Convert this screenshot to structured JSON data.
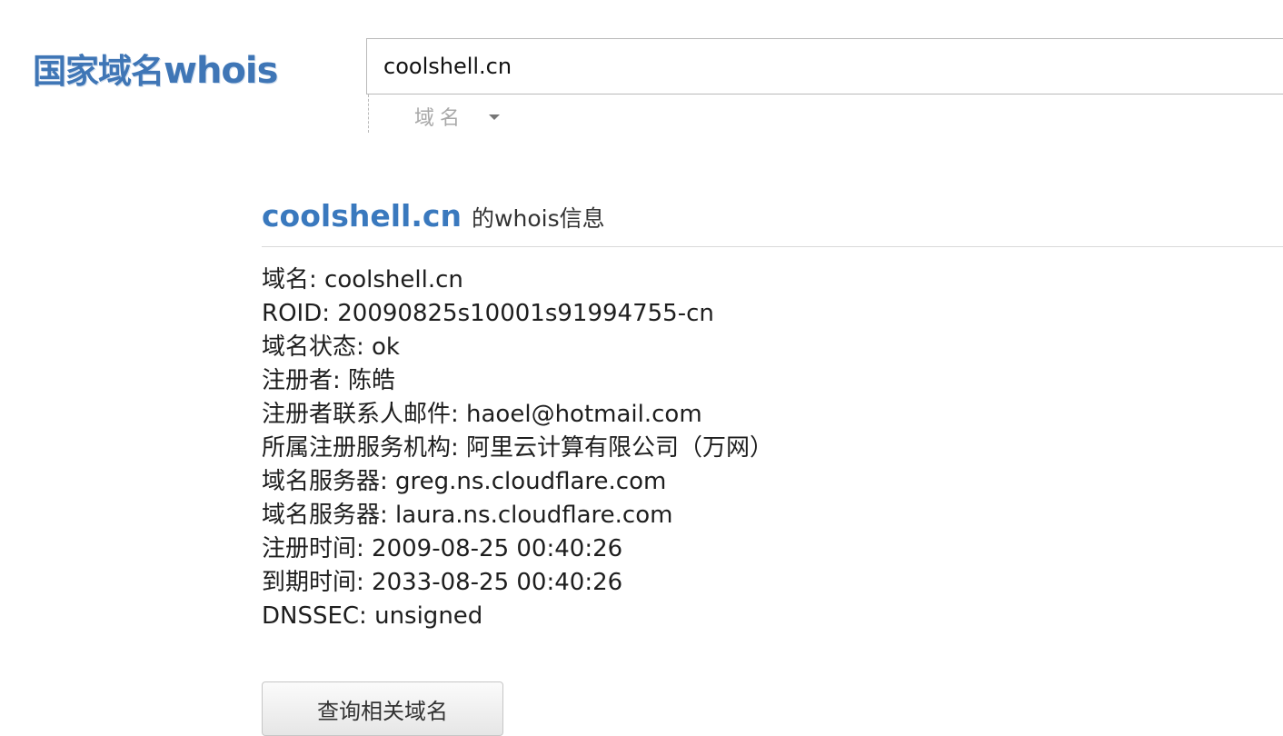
{
  "logo": {
    "cn": "国家域名",
    "en": "whois"
  },
  "search": {
    "value": "coolshell.cn",
    "type_label": "域名"
  },
  "result": {
    "domain": "coolshell.cn",
    "suffix": "的whois信息",
    "rows": [
      "域名: coolshell.cn",
      "ROID: 20090825s10001s91994755-cn",
      "域名状态: ok",
      "注册者: 陈皓",
      "注册者联系人邮件: haoel@hotmail.com",
      "所属注册服务机构: 阿里云计算有限公司（万网）",
      "域名服务器: greg.ns.cloudflare.com",
      "域名服务器: laura.ns.cloudflare.com",
      "注册时间: 2009-08-25 00:40:26",
      "到期时间: 2033-08-25 00:40:26",
      "DNSSEC: unsigned"
    ]
  },
  "related_button_label": "查询相关域名",
  "colors": {
    "brand": "#3f76b6",
    "domain_title": "#3a79be"
  }
}
